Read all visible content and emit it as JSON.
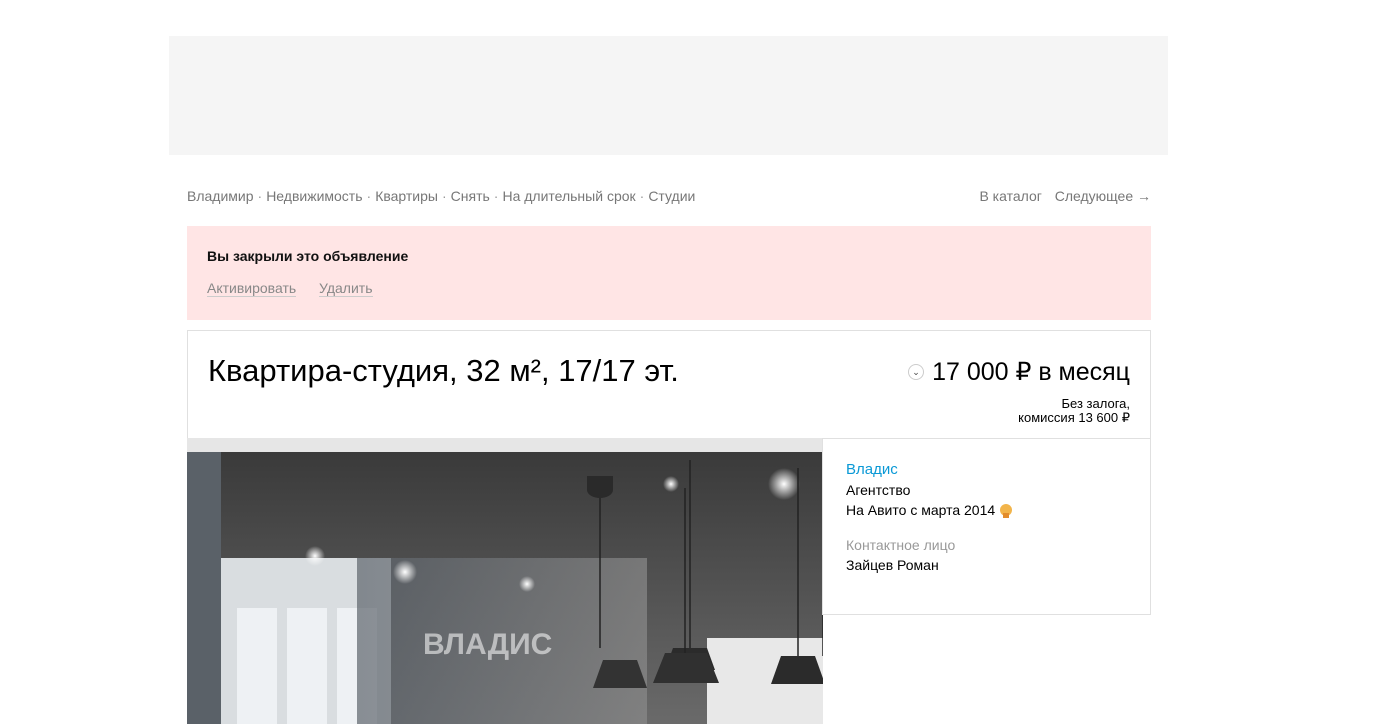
{
  "breadcrumbs": [
    "Владимир",
    "Недвижимость",
    "Квартиры",
    "Снять",
    "На длительный срок",
    "Студии"
  ],
  "breadcrumb_separator": "·",
  "topnav": {
    "catalog": "В каталог",
    "next": "Следующее →"
  },
  "closed_notice": {
    "message": "Вы закрыли это объявление",
    "activate": "Активировать",
    "delete": "Удалить"
  },
  "listing": {
    "title": "Квартира-студия, 32 м², 17/17 эт.",
    "price": "17 000 ₽ в месяц",
    "deposit": "Без залога,",
    "commission": "комиссия 13 600 ₽",
    "price_toggle_icon": "chevron-down-icon"
  },
  "photo": {
    "watermark": "ВЛАДИС"
  },
  "seller": {
    "name": "Владис",
    "type": "Агентство",
    "since": "На Авито с марта 2014",
    "contact_label": "Контактное лицо",
    "contact_name": "Зайцев Роман"
  },
  "colors": {
    "link": "#0a99d6",
    "notice_bg": "#ffe5e5",
    "banner_bg": "#f5f5f5"
  }
}
